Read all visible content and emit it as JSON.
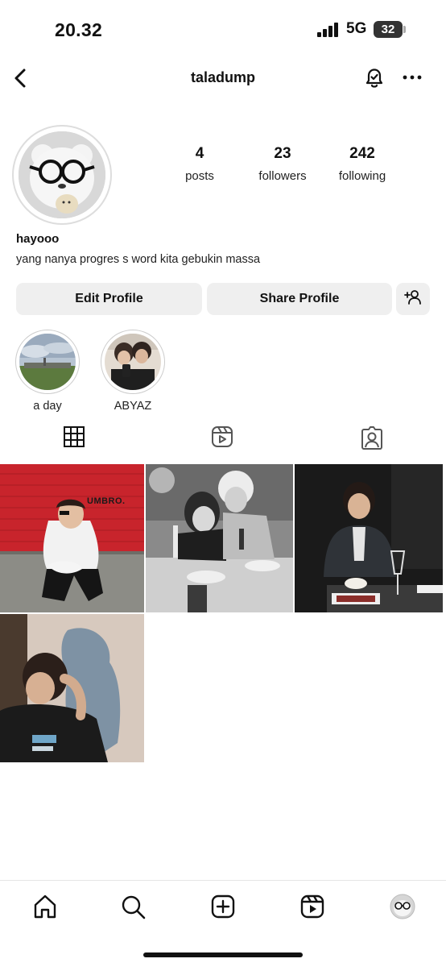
{
  "status_bar": {
    "time": "20.32",
    "network": "5G",
    "battery": "32"
  },
  "header": {
    "username": "taladump",
    "back_icon": "chevron-left-icon",
    "notify_icon": "bell-check-icon",
    "more_icon": "more-horizontal-icon"
  },
  "profile": {
    "posts": {
      "count": "4",
      "label": "posts"
    },
    "followers": {
      "count": "23",
      "label": "followers"
    },
    "following": {
      "count": "242",
      "label": "following"
    },
    "display_name": "hayooo",
    "bio": "yang nanya progres s word kita gebukin massa"
  },
  "actions": {
    "edit_label": "Edit Profile",
    "share_label": "Share Profile",
    "add_person_icon": "add-person-icon"
  },
  "highlights": [
    {
      "label": "a day"
    },
    {
      "label": "ABYAZ"
    }
  ],
  "tabs": [
    {
      "name": "grid",
      "icon": "grid-icon",
      "active": true
    },
    {
      "name": "reels",
      "icon": "reels-icon",
      "active": false
    },
    {
      "name": "tagged",
      "icon": "tagged-person-icon",
      "active": false
    }
  ],
  "posts_grid": [
    {
      "text": "UMBRO."
    },
    {
      "text": ""
    },
    {
      "text": ""
    },
    {
      "text": ""
    }
  ],
  "bottom_nav": [
    "home-icon",
    "search-icon",
    "create-icon",
    "reels-icon",
    "profile-avatar"
  ],
  "colors": {
    "button_bg": "#efefef",
    "text": "#111111",
    "red_wall": "#c8242c"
  }
}
